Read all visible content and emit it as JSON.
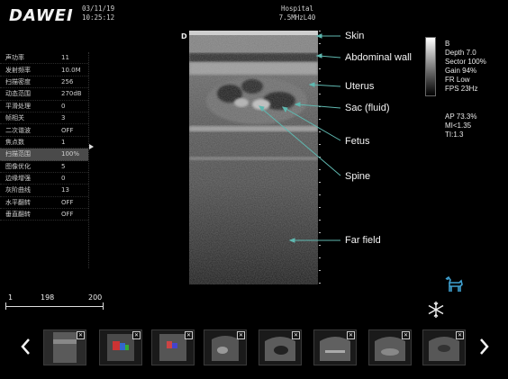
{
  "header": {
    "logo": "DAWEI",
    "date": "03/11/19",
    "time": "10:25:12",
    "facility": "Hospital",
    "probe": "7.5MHzL40"
  },
  "menu": [
    {
      "label": "声功率",
      "value": "11"
    },
    {
      "label": "发射频率",
      "value": "10.0M"
    },
    {
      "label": "扫描密度",
      "value": "256"
    },
    {
      "label": "动态范围",
      "value": "270dB"
    },
    {
      "label": "平滑处理",
      "value": "0"
    },
    {
      "label": "帧相关",
      "value": "3"
    },
    {
      "label": "二次谐波",
      "value": "OFF"
    },
    {
      "label": "焦点数",
      "value": "1"
    },
    {
      "label": "扫描范围",
      "value": "100%"
    },
    {
      "label": "图像优化",
      "value": "5"
    },
    {
      "label": "边缘增强",
      "value": "0"
    },
    {
      "label": "灰阶曲线",
      "value": "13"
    },
    {
      "label": "水平翻转",
      "value": "OFF"
    },
    {
      "label": "垂直翻转",
      "value": "OFF"
    }
  ],
  "selected_menu_index": 8,
  "orientation_marker": "D",
  "annotations": {
    "skin": "Skin",
    "abdominal_wall": "Abdominal wall",
    "uterus": "Uterus",
    "sac": "Sac (fluid)",
    "fetus": "Fetus",
    "spine": "Spine",
    "far_field": "Far field"
  },
  "info": {
    "mode": "B",
    "depth": "Depth 7.0",
    "sector": "Sector 100%",
    "gain": "Gain 94%",
    "fr": "FR Low",
    "fps": "FPS 23Hz",
    "ap": "AP 73.3%",
    "mi": "MI<1.35",
    "ti": "TI:1.3"
  },
  "scale": {
    "left": "1",
    "mid": "198",
    "right": "200"
  },
  "thumbnails_count": 8,
  "icons": {
    "body_mark": "dog-icon",
    "freeze": "snowflake-icon",
    "prev": "chevron-left-icon",
    "next": "chevron-right-icon"
  },
  "colors": {
    "annotation_line": "#5fb8b0",
    "body_mark": "#3fa0d0"
  }
}
